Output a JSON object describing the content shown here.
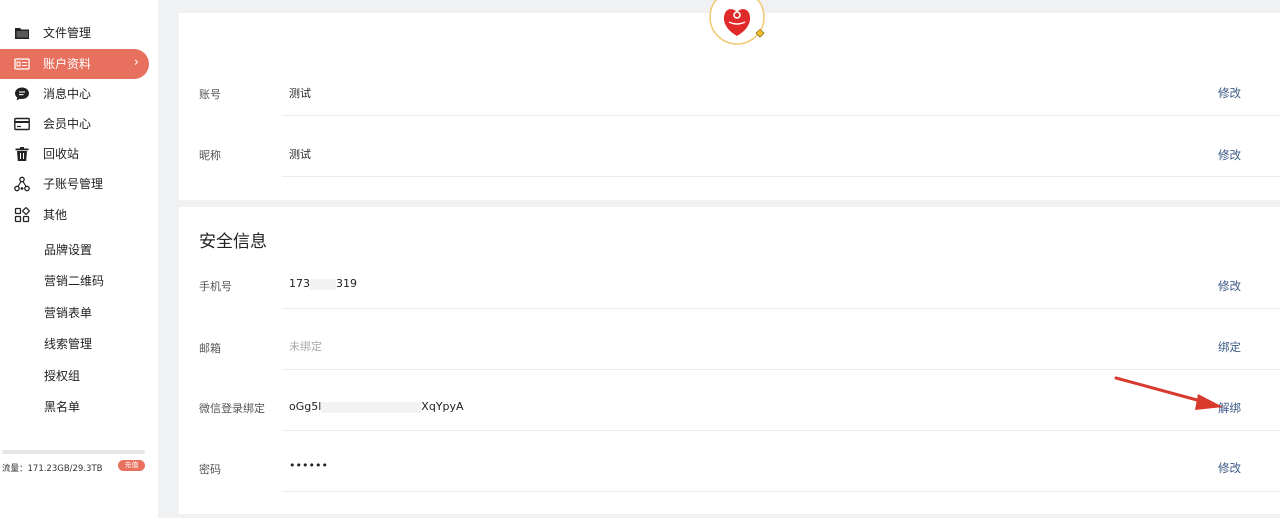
{
  "sidebar": {
    "items": [
      {
        "label": "文件管理",
        "icon": "folder-icon"
      },
      {
        "label": "账户资料",
        "icon": "profile-card-icon",
        "active": true
      },
      {
        "label": "消息中心",
        "icon": "message-icon"
      },
      {
        "label": "会员中心",
        "icon": "card-icon"
      },
      {
        "label": "回收站",
        "icon": "trash-icon"
      },
      {
        "label": "子账号管理",
        "icon": "hierarchy-icon"
      },
      {
        "label": "其他",
        "icon": "apps-icon"
      }
    ],
    "sub_items": [
      "品牌设置",
      "营销二维码",
      "营销表单",
      "线索管理",
      "授权组",
      "黑名单"
    ],
    "traffic_text": "流量：171.23GB/29.3TB",
    "recharge_label": "充值",
    "accent_color": "#e8705f"
  },
  "profile": {
    "rows": [
      {
        "label": "账号",
        "value": "测试",
        "action": "修改"
      },
      {
        "label": "昵称",
        "value": "测试",
        "action": "修改"
      }
    ]
  },
  "security": {
    "title": "安全信息",
    "phone": {
      "label": "手机号",
      "value_start": "173",
      "value_end": "319",
      "action": "修改"
    },
    "email": {
      "label": "邮箱",
      "value": "未绑定",
      "action": "绑定"
    },
    "wechat": {
      "label": "微信登录绑定",
      "value_start": "oGg5l",
      "value_end": "XqYpyA",
      "action": "解绑"
    },
    "password": {
      "label": "密码",
      "value": "••••••",
      "action": "修改"
    }
  },
  "link_color": "#3d5a86"
}
